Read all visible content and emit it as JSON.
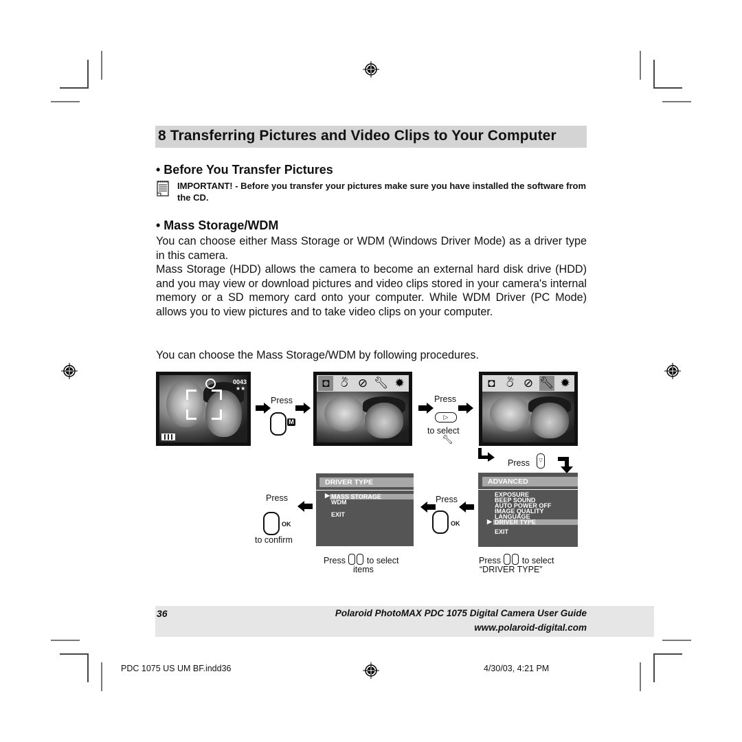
{
  "header": {
    "title": "8 Transferring Pictures and Video Clips to Your Computer"
  },
  "section1": {
    "heading": "• Before You Transfer Pictures",
    "note_icon": "notepad-icon",
    "important": "IMPORTANT! - Before you transfer your pictures make sure you have installed the software from the CD."
  },
  "section2": {
    "heading": "• Mass Storage/WDM",
    "paragraphs": [
      "You can choose either Mass Storage or WDM (Windows Driver Mode) as a driver type in this camera.",
      "Mass Storage (HDD) allows the camera to become an external hard disk drive (HDD) and you may view or download pictures and video clips stored in your camera's internal memory or a SD memory card onto your computer.  While WDM Driver (PC Mode) allows you to view pictures and to take video clips on your computer."
    ],
    "procedure_intro": "You can choose the Mass Storage/WDM by following procedures."
  },
  "diagram": {
    "screen1": {
      "counter": "0043",
      "quality": "★★",
      "icons": [
        "self-timer-icon",
        "battery-icon",
        "focus-frame-icon"
      ]
    },
    "step1": {
      "press": "Press",
      "button_badge": "M"
    },
    "screen2": {
      "icons": [
        "camera-icon",
        "self-timer-off-icon",
        "flash-off-icon",
        "wrench-icon",
        "sun-icon"
      ],
      "off_label": "OFF",
      "selected": "camera-icon"
    },
    "step2": {
      "press": "Press",
      "button_glyph": "▷",
      "select": "to select",
      "target_icon": "wrench-icon"
    },
    "screen3": {
      "icons": [
        "camera-icon",
        "self-timer-off-icon",
        "flash-off-icon",
        "wrench-icon",
        "sun-icon"
      ],
      "off_label": "OFF",
      "selected": "wrench-icon"
    },
    "step3": {
      "press": "Press",
      "button_glyph": "▽"
    },
    "advanced_menu": {
      "title": "ADVANCED",
      "items": [
        "EXPOSURE",
        "BEEP SOUND",
        "AUTO POWER OFF",
        "IMAGE QUALITY",
        "LANGUAGE",
        "DRIVER TYPE",
        "EXIT"
      ],
      "selected": "DRIVER TYPE",
      "caption_press": "Press",
      "caption_select": "to select",
      "caption_target": "“DRIVER TYPE”"
    },
    "step4": {
      "press": "Press",
      "ok": "OK"
    },
    "driver_menu": {
      "title": "DRIVER TYPE",
      "items": [
        "MASS STORAGE",
        "WDM",
        "EXIT"
      ],
      "selected": "MASS STORAGE",
      "caption_press": "Press",
      "caption_select": "to select",
      "caption_target": "items"
    },
    "step5": {
      "press": "Press",
      "ok": "OK",
      "confirm": "to confirm"
    }
  },
  "footer": {
    "page_number": "36",
    "guide_title": "Polaroid PhotoMAX PDC 1075 Digital Camera User Guide",
    "url": "www.polaroid-digital.com"
  },
  "slug": {
    "file": "PDC 1075 US UM BF.indd36",
    "timestamp": "4/30/03, 4:21 PM"
  }
}
